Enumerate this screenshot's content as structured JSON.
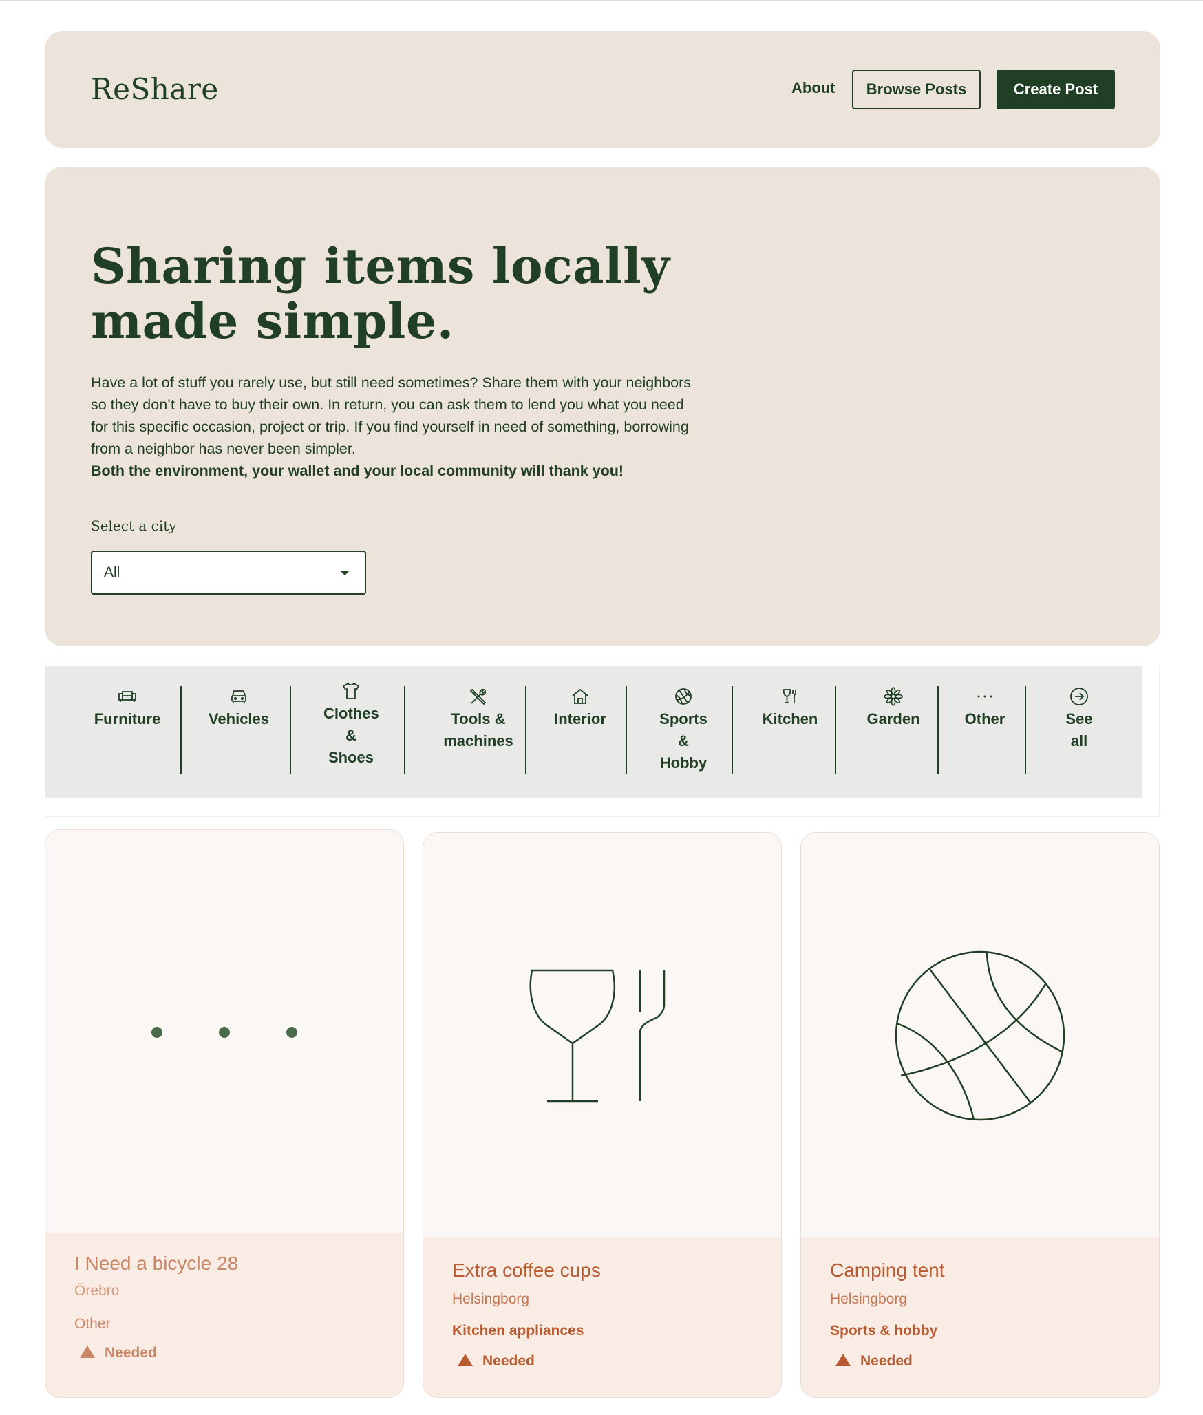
{
  "header": {
    "logo": "ReShare",
    "nav": {
      "about": "About",
      "browse": "Browse Posts",
      "create": "Create Post"
    }
  },
  "hero": {
    "title": "Sharing items locally made simple.",
    "text": "Have a lot of stuff you rarely use, but still need sometimes? Share them with your neighbors so they don’t have to buy their own. In return, you can ask them to lend you what you need for this specific occasion, project or trip. If you find yourself in need of something, borrowing from a neighbor has never been simpler.",
    "bold_text": "Both the environment, your wallet and your local community will thank you!",
    "city_label": "Select a city",
    "city_value": "All"
  },
  "categories": [
    {
      "label": "Furniture",
      "icon": "sofa-icon"
    },
    {
      "label": "Vehicles",
      "icon": "car-icon"
    },
    {
      "label": "Clothes & Shoes",
      "icon": "tshirt-icon"
    },
    {
      "label": "Tools & machines",
      "icon": "tools-icon"
    },
    {
      "label": "Interior",
      "icon": "house-icon"
    },
    {
      "label": "Sports & Hobby",
      "icon": "basketball-icon"
    },
    {
      "label": "Kitchen",
      "icon": "glass-fork-icon"
    },
    {
      "label": "Garden",
      "icon": "flower-icon"
    },
    {
      "label": "Other",
      "icon": "dots-icon"
    },
    {
      "label": "See all",
      "icon": "arrow-circle-icon"
    }
  ],
  "posts": [
    {
      "title": "I Need a bicycle 28",
      "city": "Örebro",
      "category": "Other",
      "status": "Needed",
      "icon": "dots-icon"
    },
    {
      "title": "Extra coffee cups",
      "city": "Helsingborg",
      "category": "Kitchen appliances",
      "status": "Needed",
      "icon": "glass-fork-icon"
    },
    {
      "title": "Camping tent",
      "city": "Helsingborg",
      "category": "Sports & hobby",
      "status": "Needed",
      "icon": "basketball-icon"
    }
  ],
  "colors": {
    "primary": "#213f25",
    "panel": "#ece3db",
    "category_bar": "#e9eae7",
    "accent": "#b85b30",
    "card_info": "#f8ece4"
  }
}
